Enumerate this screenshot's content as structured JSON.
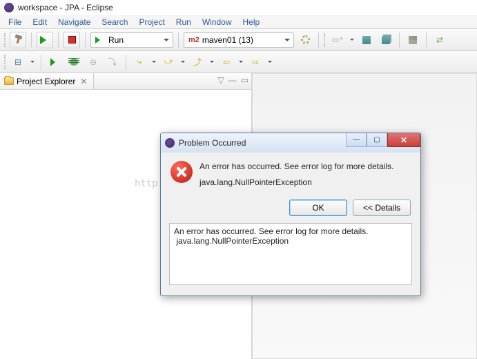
{
  "title": "workspace - JPA - Eclipse",
  "menu": [
    "File",
    "Edit",
    "Navigate",
    "Search",
    "Project",
    "Run",
    "Window",
    "Help"
  ],
  "toolbar1": {
    "run_label": "Run",
    "launch_prefix": "m2",
    "launch_label": "maven01 (13)"
  },
  "view": {
    "tab_label": "Project Explorer"
  },
  "dialog": {
    "title": "Problem Occurred",
    "message_line1": "An error has occurred. See error log for more details.",
    "message_line2": "java.lang.NullPointerException",
    "ok_label": "OK",
    "details_label": "<< Details",
    "details_text": "An error has occurred. See error log for more details.\n java.lang.NullPointerException"
  },
  "watermark": "http://blog.csdn.net/wudinaniya"
}
